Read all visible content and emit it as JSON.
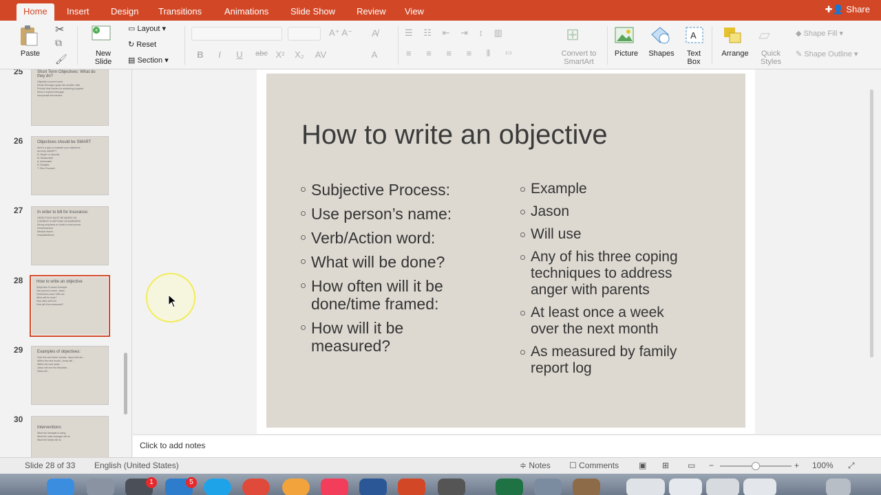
{
  "ribbon_tabs": [
    "Home",
    "Insert",
    "Design",
    "Transitions",
    "Animations",
    "Slide Show",
    "Review",
    "View"
  ],
  "share_label": "Share",
  "ribbon": {
    "paste": "Paste",
    "new_slide": "New Slide",
    "layout": "Layout",
    "reset": "Reset",
    "section": "Section",
    "convert_smartart": "Convert to SmartArt",
    "picture": "Picture",
    "shapes": "Shapes",
    "text_box": "Text Box",
    "arrange": "Arrange",
    "quick_styles": "Quick Styles",
    "shape_fill": "Shape Fill",
    "shape_outline": "Shape Outline",
    "format_buttons": [
      "B",
      "I",
      "U",
      "abc",
      "X²",
      "X₂",
      "AV",
      "A"
    ]
  },
  "thumbnails": [
    {
      "num": "25",
      "title": "Short Term Objectives: What do they do?",
      "lines": [
        "Objectify a current need",
        "Divide the larger goals into smaller units",
        "Provide time frames for assessing progress",
        "Send a hopeful message",
        "Incorporate the barriers"
      ]
    },
    {
      "num": "26",
      "title": "Objectives should be SMART",
      "lines": [
        "Here's a way to evaluate your objectives",
        "Are they SMART?",
        "S: Simple or Specific",
        "M: Measurable",
        "A: Achievable",
        "R: Realistic",
        "T: Time Focused"
      ]
    },
    {
      "num": "27",
      "title": "In order to bill for insurance:",
      "lines": [
        "OBJECTIVES MUST BE BASED ON",
        "CURRENT SYMPTOMS OR BARRIERS",
        "",
        "Strong emphasis on what is most severe:",
        "Homelessness",
        "Medical issues",
        "Hospitalizations"
      ]
    },
    {
      "num": "28",
      "title": "How to write an objective",
      "lines": [
        "Subjective Process   Example",
        "Use person's name:   Jason",
        "Verb/Action word:   Will use",
        "What will be done?",
        "How often will it be",
        "How will it be measured?"
      ]
    },
    {
      "num": "29",
      "title": "Examples of objectives:",
      "lines": [
        "Over the next three months, Jason will use ...",
        "Within the next month, Jonas will ...",
        "Within the next week, ...",
        "Jason will use his relaxation ...",
        "Maria will ..."
      ]
    },
    {
      "num": "30",
      "title": "Interventions:",
      "lines": [
        "What the therapist is doing",
        "What the case manager will do",
        "What the family will do"
      ]
    }
  ],
  "slide": {
    "title": "How to write an objective",
    "left_bullets": [
      "Subjective Process:",
      "Use person’s name:",
      "Verb/Action word:",
      "What will be done?",
      "How often will it be done/time framed:",
      "How will it be measured?"
    ],
    "right_bullets": [
      "Example",
      "Jason",
      "Will use",
      "Any of his three coping techniques to address anger with parents",
      "At least once a week over the next month",
      "As measured by family report log"
    ]
  },
  "notes_placeholder": "Click to add notes",
  "status": {
    "slide_indicator": "Slide 28 of 33",
    "language": "English (United States)",
    "notes": "Notes",
    "comments": "Comments",
    "zoom": "100%"
  },
  "dock_badges": [
    "1",
    "5"
  ],
  "colors": {
    "accent": "#d24726",
    "slide_bg": "#ddd9d1"
  }
}
